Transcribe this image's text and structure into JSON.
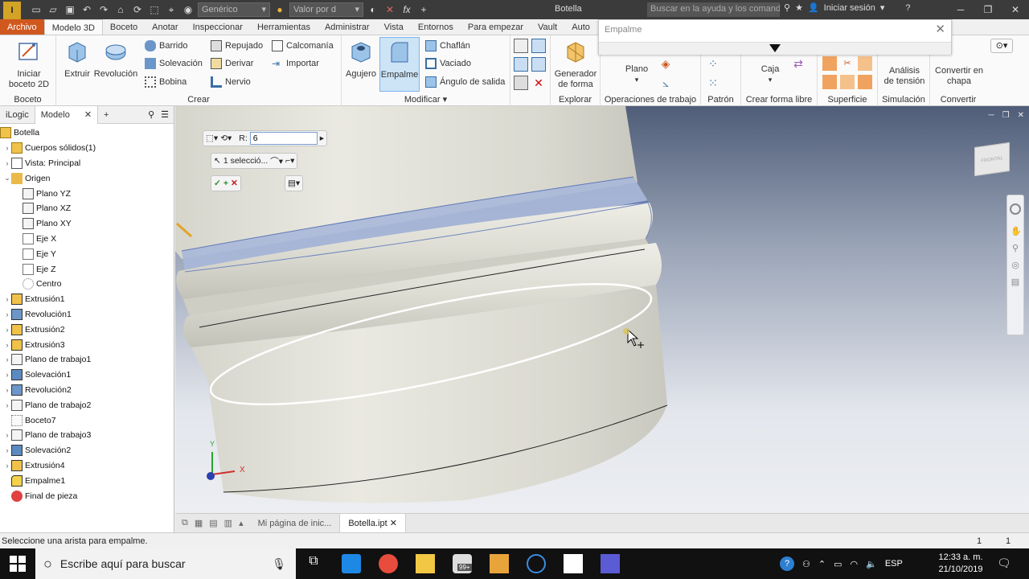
{
  "titlebar": {
    "logo": "I",
    "combo1": "Genérico",
    "combo2": "Valor por d",
    "title": "Botella",
    "search_placeholder": "Buscar en la ayuda y los comand",
    "signin": "Iniciar sesión"
  },
  "tabs": [
    "Archivo",
    "Modelo 3D",
    "Boceto",
    "Anotar",
    "Inspeccionar",
    "Herramientas",
    "Administrar",
    "Vista",
    "Entornos",
    "Para empezar",
    "Vault",
    "Auto"
  ],
  "ribbon": {
    "boceto": {
      "label": "Boceto",
      "start_sketch": "Iniciar\nboceto 2D"
    },
    "crear": {
      "label": "Crear",
      "extruir": "Extruir",
      "revolucion": "Revolución",
      "barrido": "Barrido",
      "solevacion": "Solevación",
      "bobina": "Bobina",
      "repujado": "Repujado",
      "derivar": "Derivar",
      "nervio": "Nervio",
      "calcomania": "Calcomanía",
      "importar": "Importar"
    },
    "modificar": {
      "label": "Modificar",
      "agujero": "Agujero",
      "empalme": "Empalme",
      "chaflan": "Chaflán",
      "vaciado": "Vaciado",
      "angulo": "Ángulo de salida"
    },
    "explorar": {
      "label": "Explorar",
      "generador": "Generador\nde forma"
    },
    "operaciones": {
      "label": "Operaciones de trabajo",
      "plano": "Plano"
    },
    "patron": {
      "label": "Patrón"
    },
    "formalibre": {
      "label": "Crear forma libre",
      "caja": "Caja"
    },
    "superficie": {
      "label": "Superficie"
    },
    "simulacion": {
      "label": "Simulación",
      "analisis": "Análisis\nde tensión"
    },
    "convertir": {
      "label": "Convertir",
      "chapa": "Convertir en\nchapa"
    }
  },
  "dialog": {
    "title": "Empalme"
  },
  "browser": {
    "tabs": [
      "iLogic",
      "Modelo"
    ],
    "root": "Botella",
    "items": [
      {
        "label": "Cuerpos sólidos(1)",
        "level": 1,
        "exp": "›",
        "icon": "solid-bodies-icon"
      },
      {
        "label": "Vista: Principal",
        "level": 1,
        "exp": "›",
        "icon": "view-icon"
      },
      {
        "label": "Origen",
        "level": 1,
        "exp": "⌄",
        "icon": "folder-icon"
      },
      {
        "label": "Plano YZ",
        "level": 2,
        "exp": "",
        "icon": "plane-icon"
      },
      {
        "label": "Plano XZ",
        "level": 2,
        "exp": "",
        "icon": "plane-icon"
      },
      {
        "label": "Plano XY",
        "level": 2,
        "exp": "",
        "icon": "plane-icon"
      },
      {
        "label": "Eje X",
        "level": 2,
        "exp": "",
        "icon": "axis-icon"
      },
      {
        "label": "Eje Y",
        "level": 2,
        "exp": "",
        "icon": "axis-icon"
      },
      {
        "label": "Eje Z",
        "level": 2,
        "exp": "",
        "icon": "axis-icon"
      },
      {
        "label": "Centro",
        "level": 2,
        "exp": "",
        "icon": "point-icon"
      },
      {
        "label": "Extrusión1",
        "level": 1,
        "exp": "›",
        "icon": "extrude-icon"
      },
      {
        "label": "Revolución1",
        "level": 1,
        "exp": "›",
        "icon": "revolve-icon"
      },
      {
        "label": "Extrusión2",
        "level": 1,
        "exp": "›",
        "icon": "extrude-icon"
      },
      {
        "label": "Extrusión3",
        "level": 1,
        "exp": "›",
        "icon": "extrude-icon"
      },
      {
        "label": "Plano de trabajo1",
        "level": 1,
        "exp": "›",
        "icon": "plane-icon"
      },
      {
        "label": "Solevación1",
        "level": 1,
        "exp": "›",
        "icon": "loft-icon"
      },
      {
        "label": "Revolución2",
        "level": 1,
        "exp": "›",
        "icon": "revolve-icon"
      },
      {
        "label": "Plano de trabajo2",
        "level": 1,
        "exp": "›",
        "icon": "plane-icon"
      },
      {
        "label": "Boceto7",
        "level": 1,
        "exp": "",
        "icon": "sketch-icon"
      },
      {
        "label": "Plano de trabajo3",
        "level": 1,
        "exp": "›",
        "icon": "plane-icon"
      },
      {
        "label": "Solevación2",
        "level": 1,
        "exp": "›",
        "icon": "loft-icon"
      },
      {
        "label": "Extrusión4",
        "level": 1,
        "exp": "›",
        "icon": "extrude-icon"
      },
      {
        "label": "Empalme1",
        "level": 1,
        "exp": "",
        "icon": "fillet-icon"
      },
      {
        "label": "Final de pieza",
        "level": 1,
        "exp": "",
        "icon": "end-of-part-icon"
      }
    ]
  },
  "minitoolbar": {
    "r_label": "R:",
    "r_value": "6",
    "selection": "1 selecció..."
  },
  "viewcube": {
    "face": "FRONTAL"
  },
  "axes": {
    "x": "X",
    "y": "Y"
  },
  "doctabs": [
    "Mi página de inic...",
    "Botella.ipt"
  ],
  "status": {
    "message": "Seleccione una arista para empalme.",
    "n1": "1",
    "n2": "1"
  },
  "taskbar": {
    "search": "Escribe aquí para buscar",
    "lang": "ESP",
    "time": "12:33 a. m.",
    "date": "21/10/2019",
    "badge": "99+"
  },
  "colors": {
    "file_tab": "#d0581f",
    "title_bg": "#3b3b3b",
    "selection_blue": "#6d86c9"
  }
}
